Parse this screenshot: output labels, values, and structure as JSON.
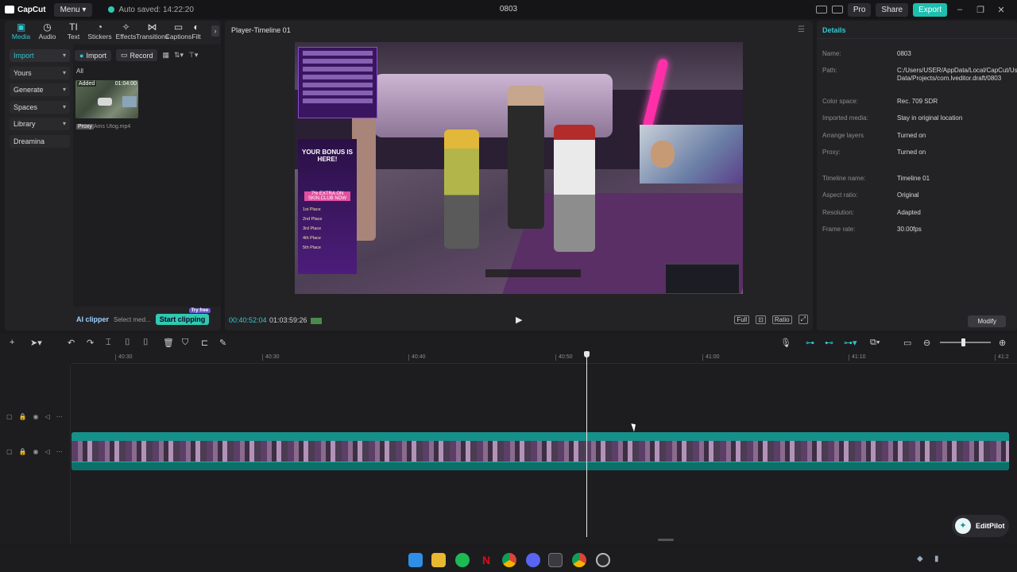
{
  "titlebar": {
    "app_name": "CapCut",
    "menu_label": "Menu",
    "autosave": "Auto saved: 14:22:20",
    "project_title": "0803",
    "pro_label": "Pro",
    "share_label": "Share",
    "export_label": "Export"
  },
  "media": {
    "tabs": [
      {
        "label": "Media",
        "icon": "media-icon"
      },
      {
        "label": "Audio",
        "icon": "audio-icon"
      },
      {
        "label": "Text",
        "icon": "text-icon"
      },
      {
        "label": "Stickers",
        "icon": "stickers-icon"
      },
      {
        "label": "Effects",
        "icon": "effects-icon"
      },
      {
        "label": "Transitions",
        "icon": "transitions-icon"
      },
      {
        "label": "Captions",
        "icon": "captions-icon"
      },
      {
        "label": "Filt",
        "icon": "filters-icon"
      }
    ],
    "nav": [
      {
        "label": "Import"
      },
      {
        "label": "Yours"
      },
      {
        "label": "Generate"
      },
      {
        "label": "Spaces"
      },
      {
        "label": "Library"
      },
      {
        "label": "Dreamina"
      }
    ],
    "import_btn": "Import",
    "record_btn": "Record",
    "all_label": "All",
    "clip": {
      "added": "Added",
      "duration": "01:04:00",
      "proxy": "Proxy",
      "filename": "Ams Utog.mp4"
    },
    "ai_clipper": "AI clipper",
    "select_media": "Select med...",
    "start_clipping": "Start clipping",
    "try_free": "Try free"
  },
  "player": {
    "title": "Player-Timeline 01",
    "current_time": "00:40:52:04",
    "total_time": "01:03:59:26",
    "controls": {
      "full": "Full",
      "ratio": "Ratio"
    },
    "video": {
      "bonus_title": "YOUR BONUS IS HERE!",
      "bonus_extra": "7% EXTRA ON SKIN.CLUB NOW",
      "places": [
        "1st Place",
        "2nd Place",
        "3rd Place",
        "4th Place",
        "5th Place"
      ]
    }
  },
  "details": {
    "title": "Details",
    "rows": [
      {
        "key": "Name:",
        "value": "0803"
      },
      {
        "key": "Path:",
        "value": "C:/Users/USER/AppData/Local/CapCut/User Data/Projects/com.lveditor.draft/0803"
      },
      {
        "key": "Color space:",
        "value": "Rec. 709 SDR"
      },
      {
        "key": "Imported media:",
        "value": "Stay in original location"
      },
      {
        "key": "Arrange layers",
        "value": "Turned on"
      },
      {
        "key": "Proxy:",
        "value": "Turned on"
      },
      {
        "key": "Timeline name:",
        "value": "Timeline 01"
      },
      {
        "key": "Aspect ratio:",
        "value": "Original"
      },
      {
        "key": "Resolution:",
        "value": "Adapted"
      },
      {
        "key": "Frame rate:",
        "value": "30.00fps"
      }
    ],
    "modify_btn": "Modify"
  },
  "timeline": {
    "ruler": [
      "40:30",
      "40:30",
      "40:40",
      "40:50",
      "41:00",
      "41:10",
      "41:2"
    ],
    "editpilot": "EditPilot"
  },
  "colors": {
    "accent": "#30c9d2",
    "export": "#1fbfb0",
    "clip": "#0f7d78"
  }
}
